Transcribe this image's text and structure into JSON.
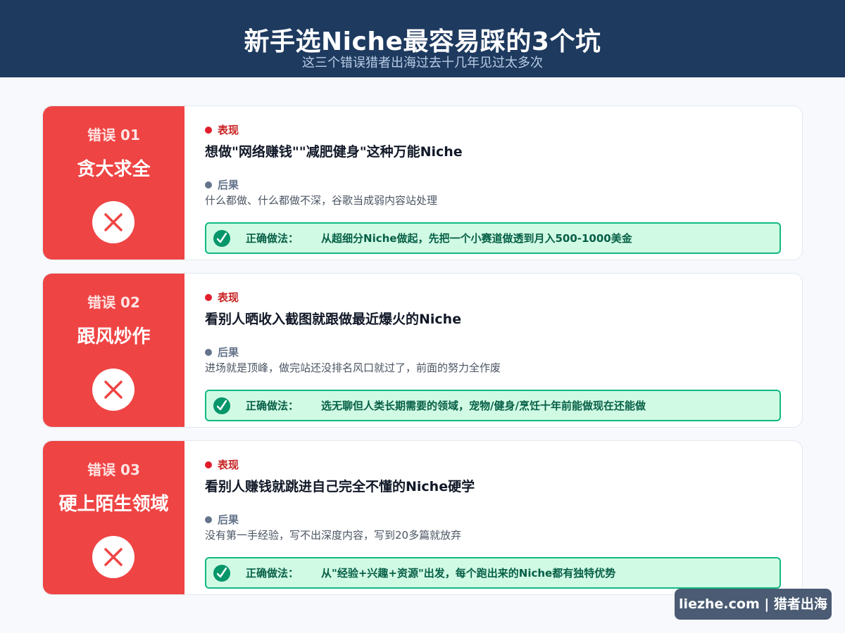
{
  "header": {
    "title": "新手选Niche最容易踩的3个坑",
    "subtitle": "这三个错误猎者出海过去十几年见过太多次"
  },
  "mistakes": [
    {
      "number": "错误 01",
      "name": "贪大求全",
      "behavior_label": "表现",
      "behavior": "想做\"网络赚钱\"\"减肥健身\"这种万能Niche",
      "consequence_label": "后果",
      "consequence": "什么都做、什么都做不深，谷歌当成弱内容站处理",
      "fix_label": "正确做法：",
      "fix": "从超细分Niche做起，先把一个小赛道做透到月入500-1000美金"
    },
    {
      "number": "错误 02",
      "name": "跟风炒作",
      "behavior_label": "表现",
      "behavior": "看别人晒收入截图就跟做最近爆火的Niche",
      "consequence_label": "后果",
      "consequence": "进场就是顶峰，做完站还没排名风口就过了，前面的努力全作废",
      "fix_label": "正确做法：",
      "fix": "选无聊但人类长期需要的领域，宠物/健身/烹饪十年前能做现在还能做"
    },
    {
      "number": "错误 03",
      "name": "硬上陌生领域",
      "behavior_label": "表现",
      "behavior": "看别人赚钱就跳进自己完全不懂的Niche硬学",
      "consequence_label": "后果",
      "consequence": "没有第一手经验，写不出深度内容，写到20多篇就放弃",
      "fix_label": "正确做法：",
      "fix": "从\"经验+兴趣+资源\"出发，每个跑出来的Niche都有独特优势"
    }
  ],
  "brand": "liezhe.com | 猎者出海",
  "colors": {
    "header_bg": "#1e3a5f",
    "mistake_red": "#ef4444",
    "fix_green": "#10b981",
    "fix_bg": "#d1fae5"
  },
  "icons": {
    "mistake": "x-circle-icon",
    "fix": "check-circle-icon"
  }
}
